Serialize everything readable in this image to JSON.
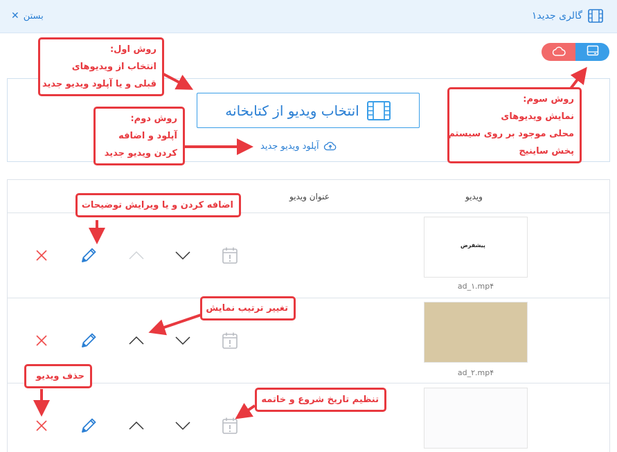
{
  "header": {
    "title": "گالری جدید۱",
    "close_label": "بستن"
  },
  "upload": {
    "choose_label": "انتخاب ویدیو از کتابخانه",
    "upload_label": "آپلود ویدیو جدید"
  },
  "table": {
    "col_video": "ویدیو",
    "col_title": "عنوان ویدیو",
    "rows": [
      {
        "thumb_text": "پیشفرض",
        "filename": "ad_۱.mp۴"
      },
      {
        "thumb_text": "",
        "filename": "ad_۲.mp۴"
      },
      {
        "thumb_text": "",
        "filename": ""
      }
    ]
  },
  "annotations": {
    "method1": [
      "روش اول:",
      "انتخاب از ویدیوهای",
      "قبلی و یا آپلود ویدیو جدید"
    ],
    "method2": [
      "روش دوم:",
      "آپلود و اضافه",
      "کردن ویدیو جدید"
    ],
    "method3": [
      "روش سوم:",
      "نمایش ویدیوهای",
      "محلی موجود بر روی سیستم",
      "پخش ساینیج"
    ],
    "edit": "اضافه کردن و یا ویرایش توضیحات",
    "order": "تغییر ترتیب نمایش",
    "delete": "حذف ویدیو",
    "schedule": "تنظیم تاریخ شروع و خاتمه"
  },
  "colors": {
    "accent": "#3a9ee8",
    "annotation": "#e8393f",
    "delete": "#ef4b4b"
  }
}
